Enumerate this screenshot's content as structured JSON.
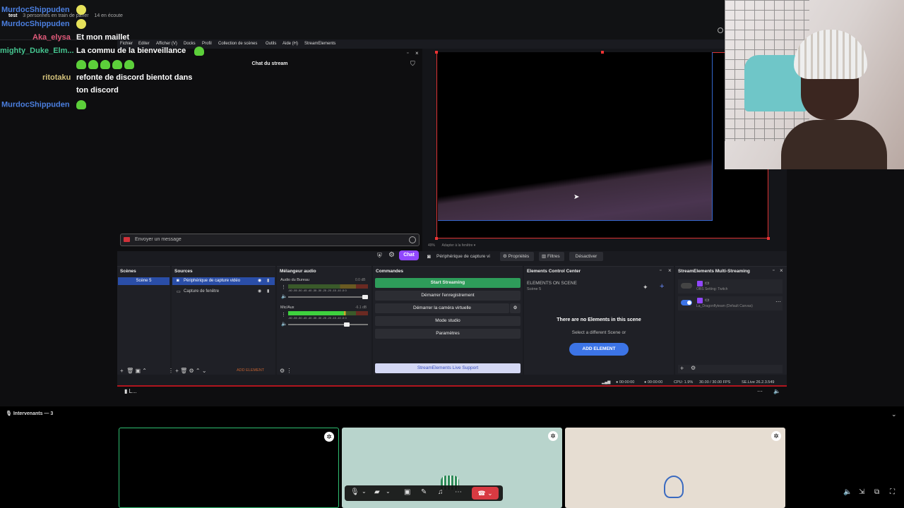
{
  "discord_top": {
    "channel": "test",
    "status_speaking": "3 personnes en train de parler",
    "status_listening": "14 en écoute"
  },
  "chat_overlay": [
    {
      "user": "MurdocShippuden",
      "message": "",
      "color": "#4b7fe0"
    },
    {
      "user": "MurdocShippuden",
      "message": "",
      "color": "#4b7fe0"
    },
    {
      "user": "Aka_elysa",
      "message": "Et mon maillet",
      "color": "#e05a7a"
    },
    {
      "user": "mighty_Duke_Elm...",
      "message": "La commu de la bienveillance",
      "color": "#45c48f"
    },
    {
      "user": "ritotaku",
      "message": "refonte de discord bientot dans",
      "message2": "ton discord",
      "color": "#d2c07a"
    },
    {
      "user": "MurdocShippuden",
      "message": "",
      "color": "#4b7fe0"
    }
  ],
  "obs": {
    "menu": [
      "Fichier",
      "Editer",
      "Afficher (V)",
      "Docks",
      "Profil",
      "Collection de scènes",
      "Outils",
      "Aide (H)",
      "StreamElements"
    ],
    "chat_title": "Chat du stream",
    "message_placeholder": "Envoyer un message",
    "chat_button": "Chat",
    "preview_zoom": "49%",
    "preview_fit": "Adapter à la fenêtre",
    "source_selected": "Périphérique de capture vi",
    "props_button": "Propriétés",
    "filters_button": "Filtres",
    "deactivate_button": "Désactiver",
    "docks": {
      "scenes": {
        "title": "Scènes",
        "items": [
          "Scène 5"
        ]
      },
      "sources": {
        "title": "Sources",
        "items": [
          "Périphérique de capture vidéo",
          "Capture de fenêtre"
        ],
        "add_element": "ADD ELEMENT"
      },
      "mixer": {
        "title": "Mélangeur audio",
        "channels": [
          {
            "name": "Audio du Bureau",
            "db": "0.0 dB"
          },
          {
            "name": "Mic/Aux",
            "db": "-6.1 dB"
          }
        ],
        "scale": "-60 -55 -50 -45 -40 -35 -30 -25 -20 -15 -10 -5 0"
      },
      "commands": {
        "title": "Commandes",
        "start_streaming": "Start Streaming",
        "record": "Démarrer l'enregistrement",
        "virtual_cam": "Démarrer la caméra virtuelle",
        "studio": "Mode studio",
        "settings": "Paramètres",
        "support": "StreamElements Live Support"
      },
      "ecc": {
        "title": "Elements Control Center",
        "elements_on_scene": "ELEMENTS ON SCENE",
        "scene": "Scène 5",
        "empty_title": "There are no Elements in this scene",
        "empty_sub": "Select a different Scene or",
        "add_button": "ADD ELEMENT"
      },
      "multistream": {
        "title": "StreamElements Multi-Streaming",
        "rows": [
          {
            "label": "OBS Setting: Twitch",
            "on": false
          },
          {
            "label": "La_Dragonflyteam (Default Canvas)",
            "on": true
          }
        ]
      }
    },
    "status": {
      "live_time": "00:00:00",
      "rec_time": "00:00:00",
      "cpu": "CPU: 1.9%",
      "fps": "30.00 / 30.00 FPS",
      "version": "SE.Live 26.2.3.549"
    }
  },
  "call": {
    "participants_label": "Intervenants — 3"
  },
  "colors": {
    "accent_purple": "#9147ff",
    "obs_green": "#2e9c5a",
    "hangup_red": "#d83a42",
    "ecc_blue": "#3c74e6"
  }
}
